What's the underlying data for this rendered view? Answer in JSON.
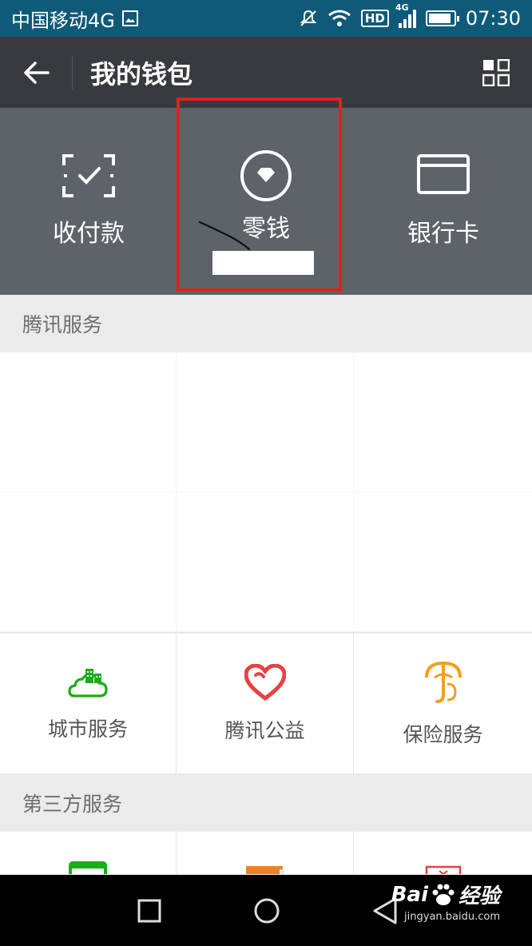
{
  "status_bar": {
    "carrier": "中国移动4G",
    "hd": "HD",
    "network": "4G",
    "battery_level": 0.9,
    "time": "07:30"
  },
  "title_bar": {
    "title": "我的钱包"
  },
  "wallet": {
    "items": [
      {
        "label": "收付款",
        "icon": "scan-pay-icon"
      },
      {
        "label": "零钱",
        "icon": "diamond-circle-icon"
      },
      {
        "label": "银行卡",
        "icon": "bank-card-icon"
      }
    ]
  },
  "tencent_services": {
    "title": "腾讯服务",
    "items": [
      {
        "label": "城市服务",
        "icon": "city-service-icon",
        "color": "#1aad19"
      },
      {
        "label": "腾讯公益",
        "icon": "charity-heart-icon",
        "color": "#e64340"
      },
      {
        "label": "保险服务",
        "icon": "insurance-umbrella-icon",
        "color": "#f0a020"
      }
    ]
  },
  "third_party": {
    "title": "第三方服务"
  },
  "watermark": {
    "brand": "Bai",
    "brand_suffix": "经验",
    "url": "jingyan.baidu.com"
  },
  "colors": {
    "statusbar": "#0e5a78",
    "titlebar": "#393a3f",
    "hero": "#5e6369",
    "highlight": "#e02020"
  }
}
